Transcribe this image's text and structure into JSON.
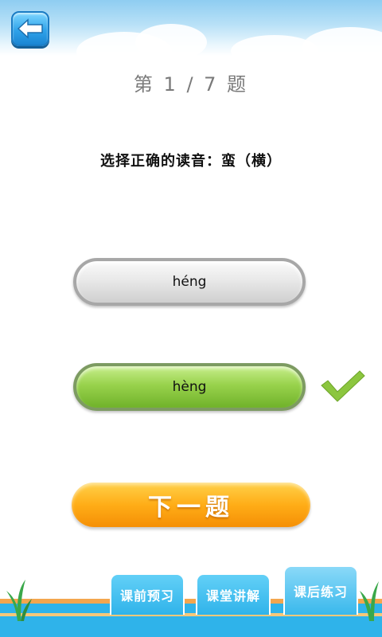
{
  "header": {
    "back_icon": "back-arrow-icon"
  },
  "quiz": {
    "counter": "第 1 / 7 题",
    "question": "选择正确的读音：蛮（横）",
    "options": [
      {
        "label": "héng",
        "state": "normal"
      },
      {
        "label": "hèng",
        "state": "selected-correct"
      }
    ],
    "correct_icon": "check-mark-icon",
    "next_label": "下一题"
  },
  "tabs": [
    {
      "label": "课前预习"
    },
    {
      "label": "课堂讲解"
    },
    {
      "label": "课后练习",
      "active": true
    }
  ],
  "colors": {
    "accent_orange": "#ffad17",
    "correct_green": "#98d24c",
    "tab_blue": "#2fb3ea"
  }
}
